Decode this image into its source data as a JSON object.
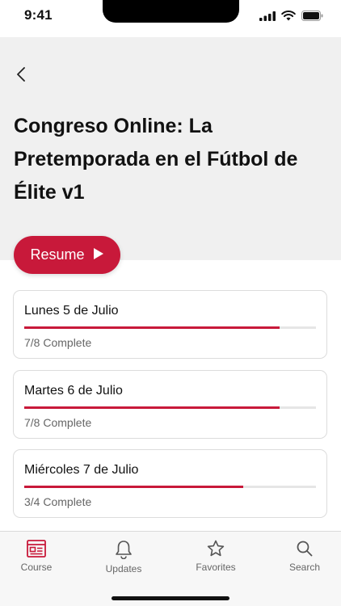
{
  "status_bar": {
    "time": "9:41"
  },
  "header": {
    "title": "Congreso Online: La Pretemporada en el Fútbol de Élite v1"
  },
  "resume_button": {
    "label": "Resume",
    "icon": "play-icon"
  },
  "days": [
    {
      "title": "Lunes 5 de Julio",
      "status": "7/8 Complete",
      "progress": 0.875
    },
    {
      "title": "Martes 6 de Julio",
      "status": "7/8 Complete",
      "progress": 0.875
    },
    {
      "title": "Miércoles 7 de Julio",
      "status": "3/4 Complete",
      "progress": 0.75
    }
  ],
  "tabs": [
    {
      "label": "Course",
      "icon": "course-icon"
    },
    {
      "label": "Updates",
      "icon": "bell-icon"
    },
    {
      "label": "Favorites",
      "icon": "star-icon"
    },
    {
      "label": "Search",
      "icon": "search-icon"
    }
  ],
  "colors": {
    "accent": "#c8193a",
    "header_bg": "#f0f0f0"
  }
}
